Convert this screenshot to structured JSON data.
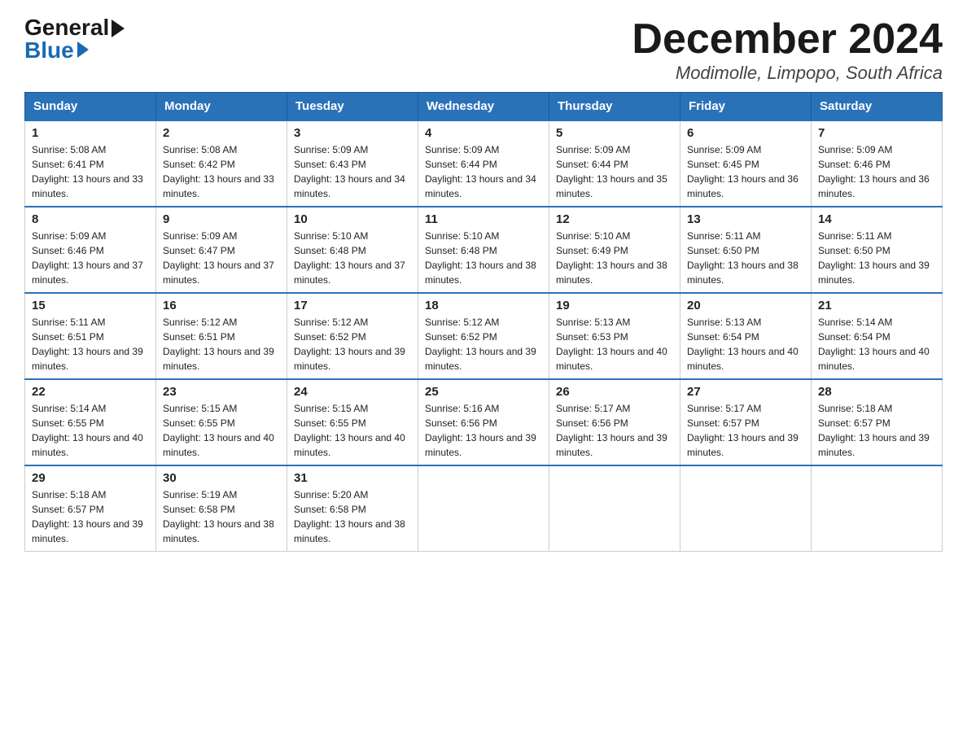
{
  "logo": {
    "general": "General",
    "blue": "Blue"
  },
  "title": "December 2024",
  "location": "Modimolle, Limpopo, South Africa",
  "days_of_week": [
    "Sunday",
    "Monday",
    "Tuesday",
    "Wednesday",
    "Thursday",
    "Friday",
    "Saturday"
  ],
  "weeks": [
    [
      {
        "day": "1",
        "sunrise": "5:08 AM",
        "sunset": "6:41 PM",
        "daylight": "13 hours and 33 minutes."
      },
      {
        "day": "2",
        "sunrise": "5:08 AM",
        "sunset": "6:42 PM",
        "daylight": "13 hours and 33 minutes."
      },
      {
        "day": "3",
        "sunrise": "5:09 AM",
        "sunset": "6:43 PM",
        "daylight": "13 hours and 34 minutes."
      },
      {
        "day": "4",
        "sunrise": "5:09 AM",
        "sunset": "6:44 PM",
        "daylight": "13 hours and 34 minutes."
      },
      {
        "day": "5",
        "sunrise": "5:09 AM",
        "sunset": "6:44 PM",
        "daylight": "13 hours and 35 minutes."
      },
      {
        "day": "6",
        "sunrise": "5:09 AM",
        "sunset": "6:45 PM",
        "daylight": "13 hours and 36 minutes."
      },
      {
        "day": "7",
        "sunrise": "5:09 AM",
        "sunset": "6:46 PM",
        "daylight": "13 hours and 36 minutes."
      }
    ],
    [
      {
        "day": "8",
        "sunrise": "5:09 AM",
        "sunset": "6:46 PM",
        "daylight": "13 hours and 37 minutes."
      },
      {
        "day": "9",
        "sunrise": "5:09 AM",
        "sunset": "6:47 PM",
        "daylight": "13 hours and 37 minutes."
      },
      {
        "day": "10",
        "sunrise": "5:10 AM",
        "sunset": "6:48 PM",
        "daylight": "13 hours and 37 minutes."
      },
      {
        "day": "11",
        "sunrise": "5:10 AM",
        "sunset": "6:48 PM",
        "daylight": "13 hours and 38 minutes."
      },
      {
        "day": "12",
        "sunrise": "5:10 AM",
        "sunset": "6:49 PM",
        "daylight": "13 hours and 38 minutes."
      },
      {
        "day": "13",
        "sunrise": "5:11 AM",
        "sunset": "6:50 PM",
        "daylight": "13 hours and 38 minutes."
      },
      {
        "day": "14",
        "sunrise": "5:11 AM",
        "sunset": "6:50 PM",
        "daylight": "13 hours and 39 minutes."
      }
    ],
    [
      {
        "day": "15",
        "sunrise": "5:11 AM",
        "sunset": "6:51 PM",
        "daylight": "13 hours and 39 minutes."
      },
      {
        "day": "16",
        "sunrise": "5:12 AM",
        "sunset": "6:51 PM",
        "daylight": "13 hours and 39 minutes."
      },
      {
        "day": "17",
        "sunrise": "5:12 AM",
        "sunset": "6:52 PM",
        "daylight": "13 hours and 39 minutes."
      },
      {
        "day": "18",
        "sunrise": "5:12 AM",
        "sunset": "6:52 PM",
        "daylight": "13 hours and 39 minutes."
      },
      {
        "day": "19",
        "sunrise": "5:13 AM",
        "sunset": "6:53 PM",
        "daylight": "13 hours and 40 minutes."
      },
      {
        "day": "20",
        "sunrise": "5:13 AM",
        "sunset": "6:54 PM",
        "daylight": "13 hours and 40 minutes."
      },
      {
        "day": "21",
        "sunrise": "5:14 AM",
        "sunset": "6:54 PM",
        "daylight": "13 hours and 40 minutes."
      }
    ],
    [
      {
        "day": "22",
        "sunrise": "5:14 AM",
        "sunset": "6:55 PM",
        "daylight": "13 hours and 40 minutes."
      },
      {
        "day": "23",
        "sunrise": "5:15 AM",
        "sunset": "6:55 PM",
        "daylight": "13 hours and 40 minutes."
      },
      {
        "day": "24",
        "sunrise": "5:15 AM",
        "sunset": "6:55 PM",
        "daylight": "13 hours and 40 minutes."
      },
      {
        "day": "25",
        "sunrise": "5:16 AM",
        "sunset": "6:56 PM",
        "daylight": "13 hours and 39 minutes."
      },
      {
        "day": "26",
        "sunrise": "5:17 AM",
        "sunset": "6:56 PM",
        "daylight": "13 hours and 39 minutes."
      },
      {
        "day": "27",
        "sunrise": "5:17 AM",
        "sunset": "6:57 PM",
        "daylight": "13 hours and 39 minutes."
      },
      {
        "day": "28",
        "sunrise": "5:18 AM",
        "sunset": "6:57 PM",
        "daylight": "13 hours and 39 minutes."
      }
    ],
    [
      {
        "day": "29",
        "sunrise": "5:18 AM",
        "sunset": "6:57 PM",
        "daylight": "13 hours and 39 minutes."
      },
      {
        "day": "30",
        "sunrise": "5:19 AM",
        "sunset": "6:58 PM",
        "daylight": "13 hours and 38 minutes."
      },
      {
        "day": "31",
        "sunrise": "5:20 AM",
        "sunset": "6:58 PM",
        "daylight": "13 hours and 38 minutes."
      },
      null,
      null,
      null,
      null
    ]
  ]
}
